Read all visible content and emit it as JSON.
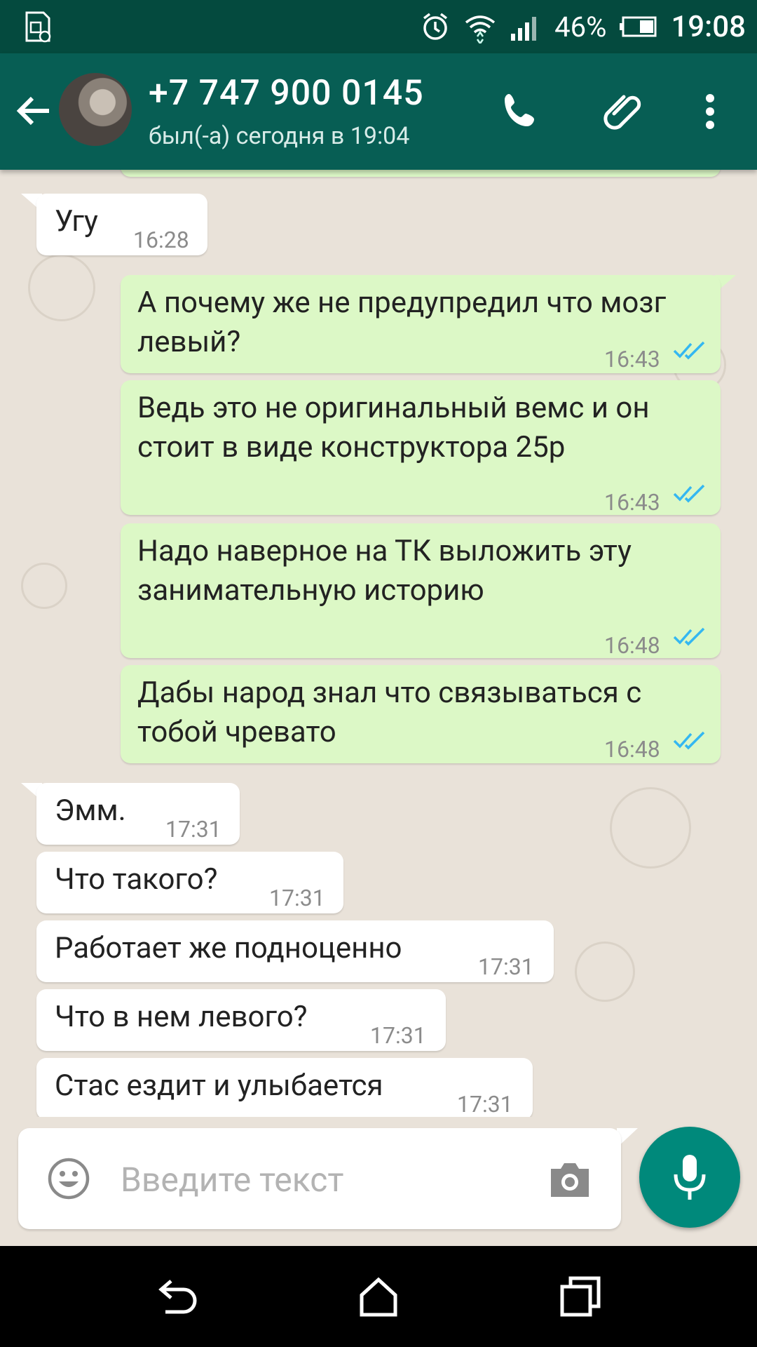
{
  "status_bar": {
    "battery": "46%",
    "time": "19:08"
  },
  "header": {
    "contact": "+7 747 900 0145",
    "last_seen": "был(-а) сегодня в 19:04"
  },
  "messages": [
    {
      "id": "m1",
      "dir": "in",
      "text": "Угу",
      "time": "16:28"
    },
    {
      "id": "m2",
      "dir": "out",
      "text": "А почему же не предупредил что мозг левый?",
      "time": "16:43"
    },
    {
      "id": "m3",
      "dir": "out",
      "text": "Ведь это не оригинальный вемс и он стоит в виде конструктора 25р",
      "time": "16:43"
    },
    {
      "id": "m4",
      "dir": "out",
      "text": "Надо наверное на ТК выложить эту занимательную историю",
      "time": "16:48"
    },
    {
      "id": "m5",
      "dir": "out",
      "text": "Дабы народ знал что связываться с тобой чревато",
      "time": "16:48"
    },
    {
      "id": "m6",
      "dir": "in",
      "text": "Эмм.",
      "time": "17:31"
    },
    {
      "id": "m7",
      "dir": "in",
      "text": "Что такого?",
      "time": "17:31"
    },
    {
      "id": "m8",
      "dir": "in",
      "text": "Работает же подноценно",
      "time": "17:31"
    },
    {
      "id": "m9",
      "dir": "in",
      "text": "Что в нем левого?",
      "time": "17:31"
    },
    {
      "id": "m10",
      "dir": "in",
      "text": "Стас ездит и улыбается",
      "time": "17:31"
    }
  ],
  "composer": {
    "placeholder": "Введите текст"
  },
  "colors": {
    "header": "#075e54",
    "status_bar": "#044a3e",
    "outgoing": "#dcf8c6",
    "incoming": "#ffffff",
    "fab": "#00897b",
    "read_ticks": "#34b7f1"
  }
}
